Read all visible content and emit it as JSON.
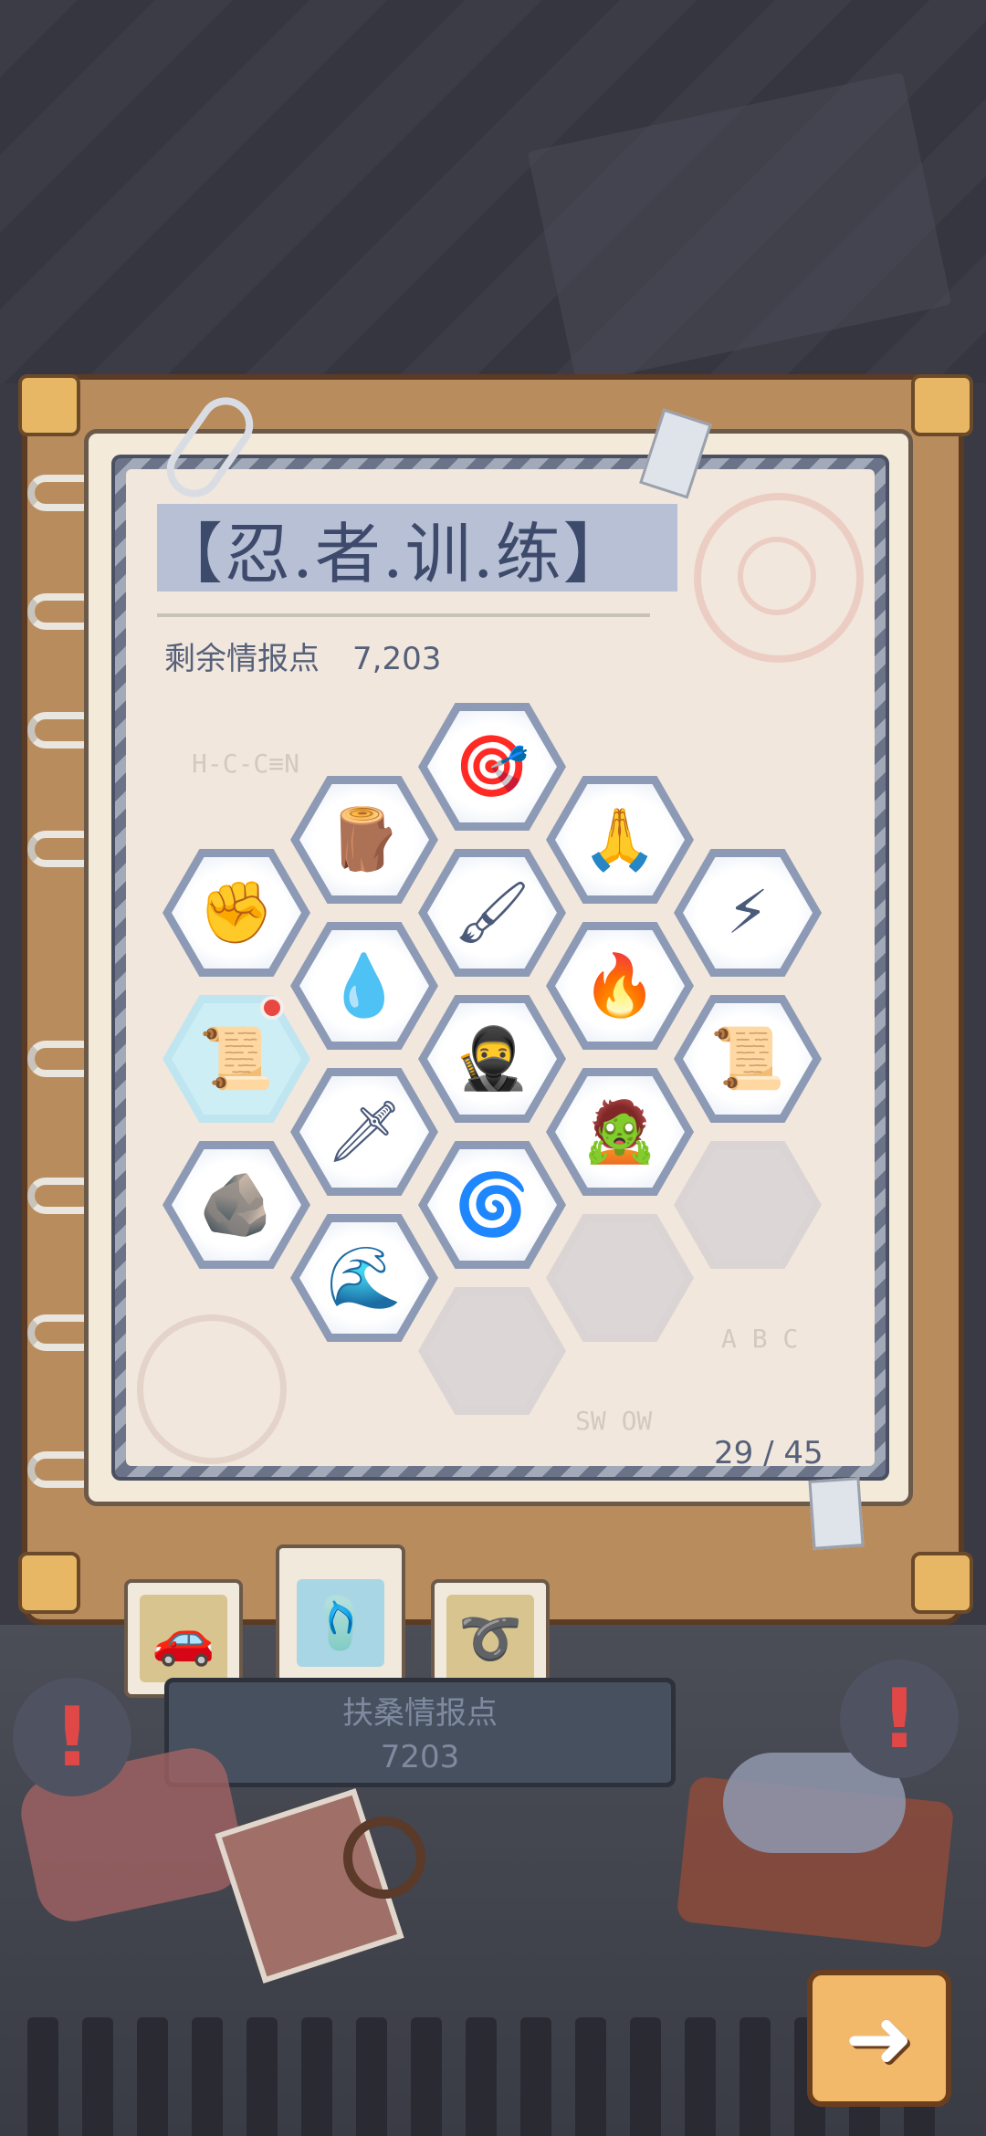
{
  "notebook": {
    "title": "【忍.者.训.练】",
    "remaining_label": "剩余情报点",
    "remaining_value": "7,203",
    "progress_text": "29 / 45",
    "progress": {
      "current": 29,
      "total": 45
    }
  },
  "skills": [
    {
      "icon": "target-dart-icon",
      "glyph": "🎯",
      "state": "unlocked"
    },
    {
      "icon": "barrel-icon",
      "glyph": "🪵",
      "state": "unlocked"
    },
    {
      "icon": "praying-hands-icon",
      "glyph": "🙏",
      "state": "unlocked"
    },
    {
      "icon": "fist-icon",
      "glyph": "✊",
      "state": "unlocked"
    },
    {
      "icon": "paintbrush-scroll-icon",
      "glyph": "🖌",
      "state": "unlocked"
    },
    {
      "icon": "lightning-fist-icon",
      "glyph": "⚡",
      "state": "unlocked"
    },
    {
      "icon": "water-orb-icon",
      "glyph": "💧",
      "state": "unlocked"
    },
    {
      "icon": "fire-fist-icon",
      "glyph": "🔥",
      "state": "unlocked"
    },
    {
      "icon": "scroll-icon",
      "glyph": "📜",
      "state": "available"
    },
    {
      "icon": "ninja-icon",
      "glyph": "🥷",
      "state": "unlocked"
    },
    {
      "icon": "scroll-seal-icon",
      "glyph": "📜",
      "state": "unlocked"
    },
    {
      "icon": "ninja-dash-icon",
      "glyph": "🗡",
      "state": "unlocked"
    },
    {
      "icon": "zombie-head-icon",
      "glyph": "🧟",
      "state": "unlocked"
    },
    {
      "icon": "dirt-dig-icon",
      "glyph": "🪨",
      "state": "unlocked"
    },
    {
      "icon": "spiral-snail-icon",
      "glyph": "🌀",
      "state": "unlocked"
    },
    {
      "icon": "water-wave-icon",
      "glyph": "🌊",
      "state": "unlocked"
    },
    {
      "icon": "locked-slot",
      "glyph": "",
      "state": "locked"
    },
    {
      "icon": "locked-slot",
      "glyph": "",
      "state": "locked"
    },
    {
      "icon": "locked-slot",
      "glyph": "",
      "state": "locked"
    }
  ],
  "tabs": [
    {
      "name": "car-icon",
      "glyph": "🚗",
      "active": false
    },
    {
      "name": "sandals-icon",
      "glyph": "🩴",
      "active": true
    },
    {
      "name": "scroll-ring-icon",
      "glyph": "➰",
      "active": false
    }
  ],
  "info_box": {
    "label": "扶桑情报点",
    "value": "7203"
  },
  "alerts": [
    "!",
    "!"
  ],
  "next_button": {
    "glyph": "➜"
  },
  "colors": {
    "title_bg": "#b7c0d4",
    "title_text": "#3e4a6b",
    "red_dot": "#e8483f",
    "button_orange": "#f2b96a"
  }
}
